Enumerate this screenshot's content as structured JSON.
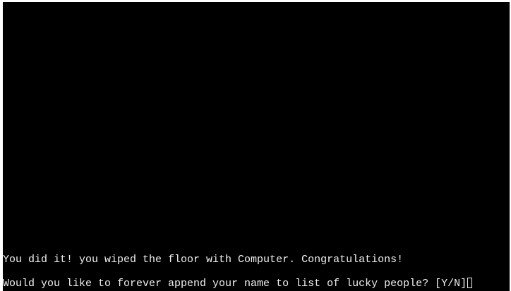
{
  "terminal": {
    "lines": [
      "You did it! you wiped the floor with Computer. Congratulations!",
      "Would you like to forever append your name to list of lucky people? [Y/N]"
    ],
    "cursor": "block-cursor-outline",
    "colors": {
      "background": "#000000",
      "text": "#f0f0f0"
    }
  }
}
